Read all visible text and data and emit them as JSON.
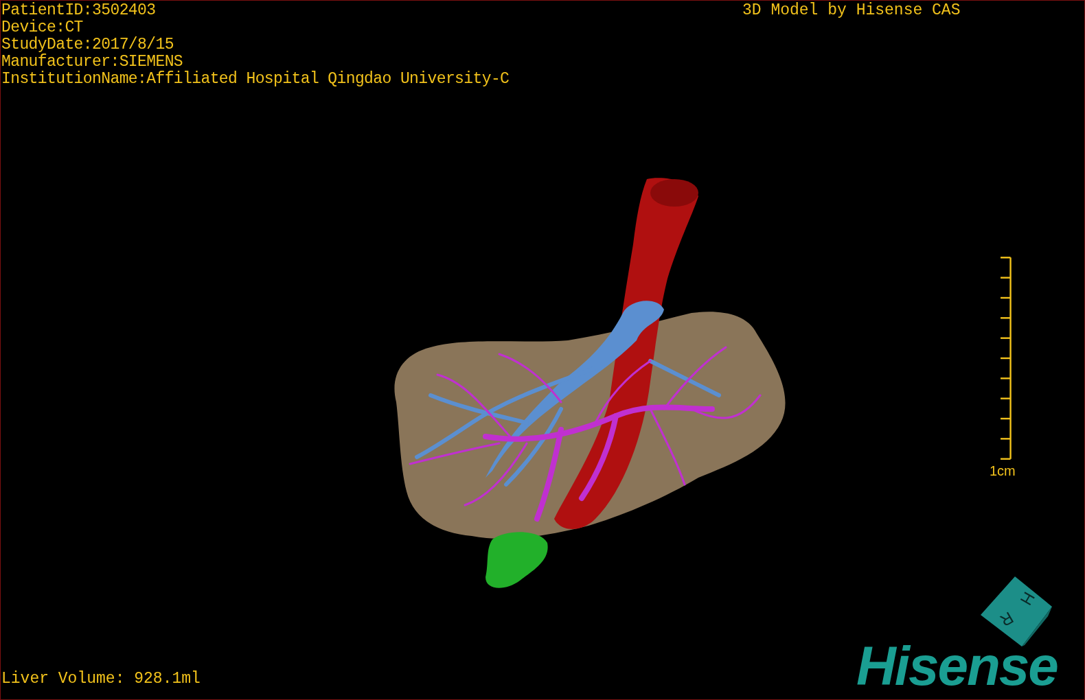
{
  "patient_info": [
    "PatientID:3502403",
    "Device:CT",
    "StudyDate:2017/8/15",
    "Manufacturer:SIEMENS",
    "InstitutionName:Affiliated Hospital Qingdao University-C"
  ],
  "title": "3D Model by Hisense CAS",
  "scale_bar": {
    "label": "1cm"
  },
  "liver_volume": "Liver Volume: 928.1ml",
  "orientation_cube": {
    "labels": [
      "H",
      "R"
    ]
  },
  "logo": "Hisense"
}
